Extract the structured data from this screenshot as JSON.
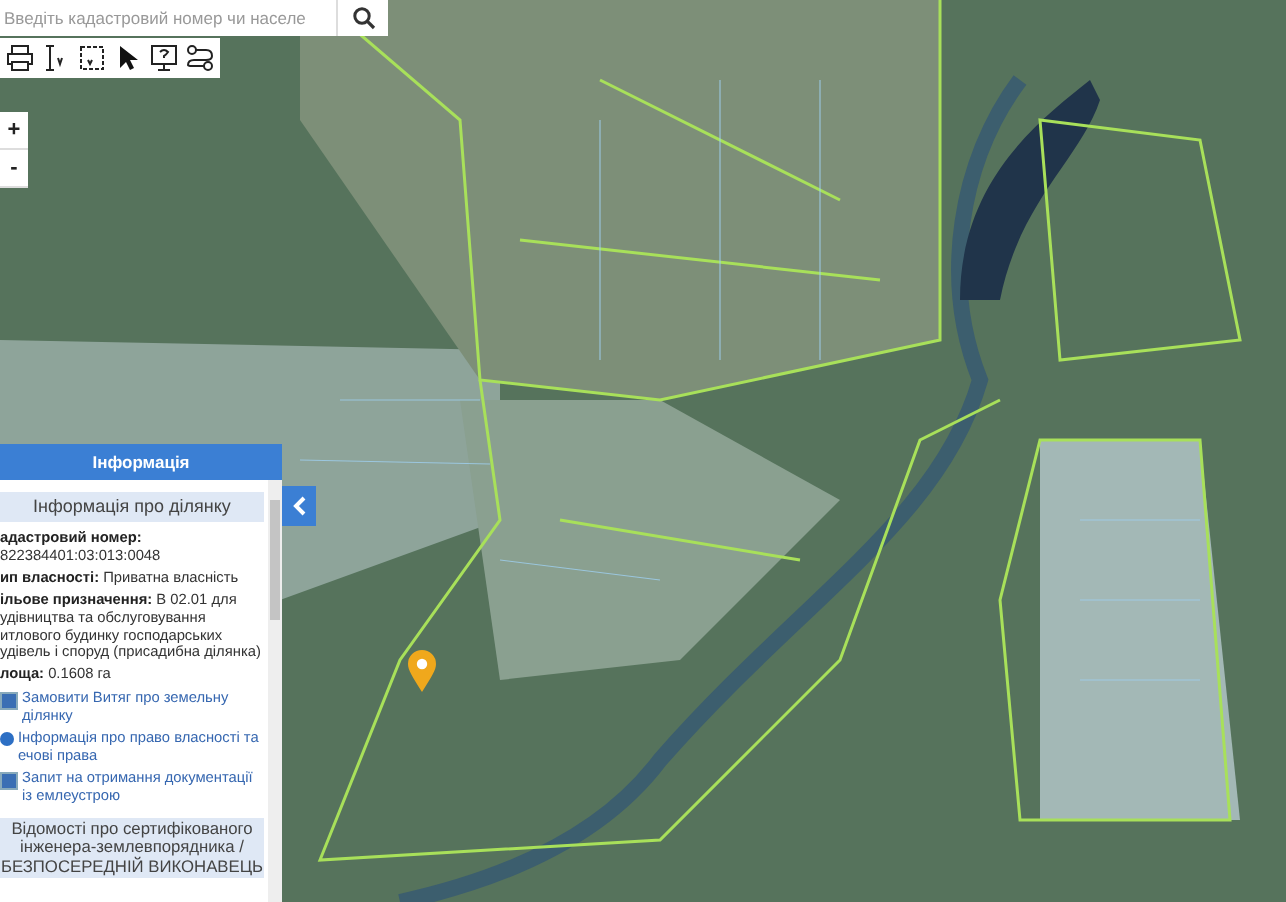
{
  "search": {
    "placeholder": "Введіть кадастровий номер чи населе"
  },
  "zoom_controls": [
    "+",
    "-"
  ],
  "info_panel": {
    "title": "Інформація",
    "section_title": "Інформація про ділянку",
    "fields": [
      {
        "kind": "block",
        "label": "адастровий номер:",
        "value": "822384401:03:013:0048"
      },
      {
        "kind": "inline",
        "label": "ип власності:",
        "value": "Приватна власність"
      },
      {
        "kind": "inline",
        "label": "ільове призначення:",
        "value": "В 02.01 для удівництва та обслуговування итлового будинку господарських удівель і споруд (присадибна ділянка)"
      },
      {
        "kind": "inline",
        "label": "лоща:",
        "value": "0.1608 га"
      }
    ],
    "links": [
      {
        "kind": "document",
        "text": "Замовити Витяг про земельну ділянку"
      },
      {
        "kind": "info",
        "text": "Інформація про право власності та ечові права"
      },
      {
        "kind": "document",
        "text": "Запит на отримання документації із емлеустрою"
      }
    ],
    "engineer_title": "Відомості про сертифікованого інженера-землевпорядника / БЕЗПОСЕРЕДНІЙ ВИКОНАВЕЦЬ"
  }
}
